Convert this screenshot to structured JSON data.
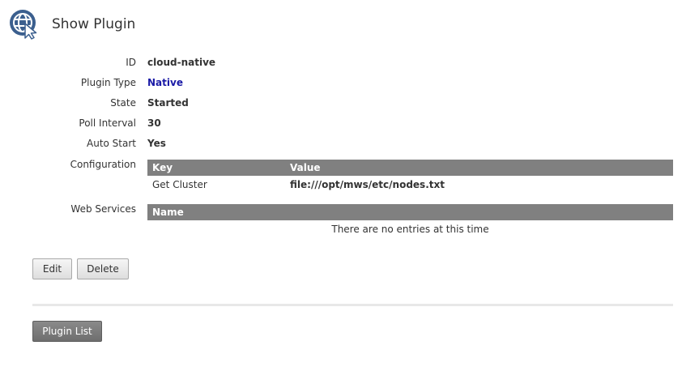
{
  "header": {
    "title": "Show Plugin",
    "icon": "globe-cursor-icon"
  },
  "fields": {
    "id": {
      "label": "ID",
      "value": "cloud-native"
    },
    "plugin_type": {
      "label": "Plugin Type",
      "value": "Native"
    },
    "state": {
      "label": "State",
      "value": "Started"
    },
    "poll_interval": {
      "label": "Poll Interval",
      "value": "30"
    },
    "auto_start": {
      "label": "Auto Start",
      "value": "Yes"
    }
  },
  "configuration": {
    "label": "Configuration",
    "columns": [
      "Key",
      "Value"
    ],
    "rows": [
      {
        "key": "Get Cluster",
        "value": "file:///opt/mws/etc/nodes.txt"
      }
    ]
  },
  "web_services": {
    "label": "Web Services",
    "columns": [
      "Name"
    ],
    "empty_message": "There are no entries at this time"
  },
  "actions": {
    "edit": "Edit",
    "delete": "Delete",
    "plugin_list": "Plugin List"
  },
  "colors": {
    "native_link": "#1a1aa6",
    "grid_header_bg": "#808080",
    "icon_blue": "#3b5f8e"
  }
}
